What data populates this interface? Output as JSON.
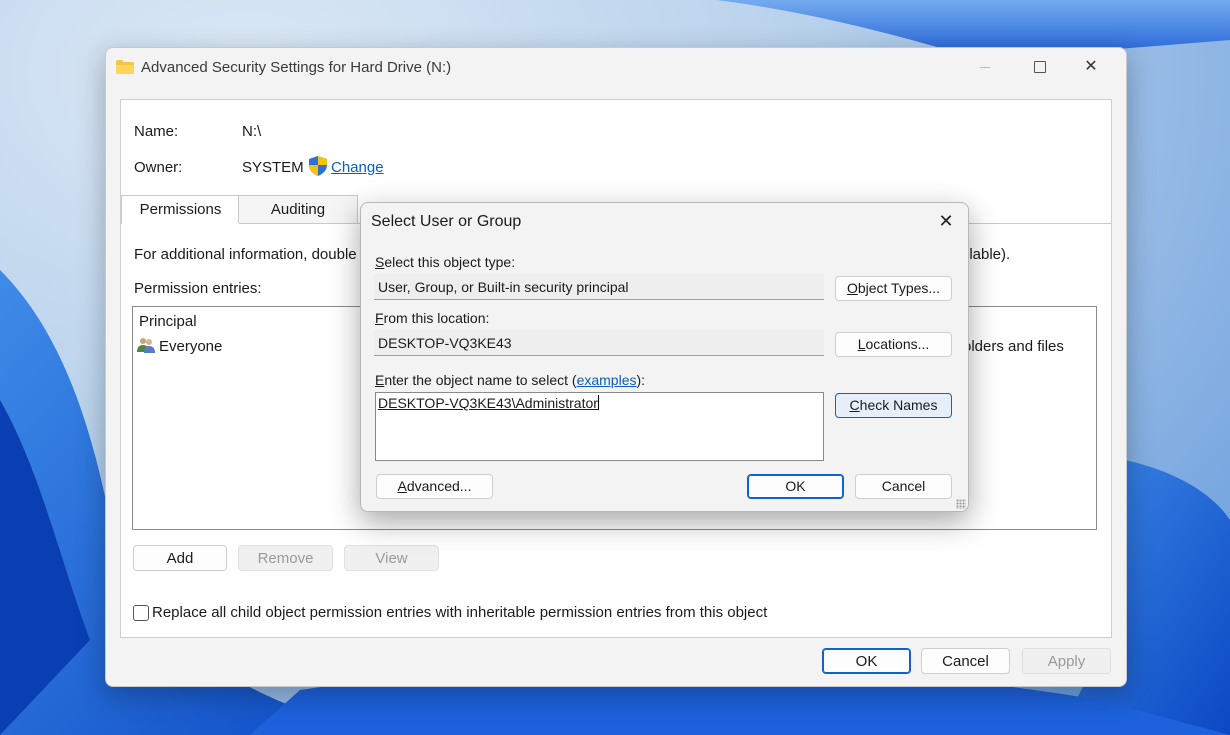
{
  "window": {
    "title": "Advanced Security Settings for Hard Drive (N:)",
    "name_label": "Name:",
    "name_value": "N:\\",
    "owner_label": "Owner:",
    "owner_value": "SYSTEM",
    "change_link": "Change",
    "tabs": [
      {
        "label": "Permissions",
        "active": true
      },
      {
        "label": "Auditing",
        "active": false
      }
    ],
    "info_text": "For additional information, double",
    "info_text_tail": "ilable).",
    "permission_entries_label": "Permission entries:",
    "column_principal": "Principal",
    "entries": [
      {
        "principal": "Everyone",
        "applies_to_tail": "olders and files"
      }
    ],
    "add_button": "Add",
    "remove_button": "Remove",
    "view_button": "View",
    "replace_checkbox_label": "Replace all child object permission entries with inheritable permission entries from this object",
    "replace_checked": false,
    "ok_button": "OK",
    "cancel_button": "Cancel",
    "apply_button": "Apply"
  },
  "dialog": {
    "title": "Select User or Group",
    "object_type_label_ak": "S",
    "object_type_label_rest": "elect this object type:",
    "object_type_value": "User, Group, or Built-in security principal",
    "object_types_button_ak": "O",
    "object_types_button_rest": "bject Types...",
    "location_label_ak": "F",
    "location_label_rest": "rom this location:",
    "location_value": "DESKTOP-VQ3KE43",
    "locations_button_ak": "L",
    "locations_button_rest": "ocations...",
    "enter_label_ak": "E",
    "enter_label_rest": "nter the object name to select (",
    "examples_link": "examples",
    "enter_label_end": "):",
    "object_name_value": "DESKTOP-VQ3KE43\\Administrator",
    "check_names_button_ak": "C",
    "check_names_button_rest": "heck Names",
    "advanced_button_ak": "A",
    "advanced_button_rest": "dvanced...",
    "ok_button": "OK",
    "cancel_button": "Cancel"
  },
  "icons": {
    "folder": "folder-icon",
    "shield": "uac-shield-icon",
    "users": "users-icon",
    "close": "close-icon"
  },
  "colors": {
    "accent": "#0f62c7",
    "link": "#0a5fbf"
  }
}
